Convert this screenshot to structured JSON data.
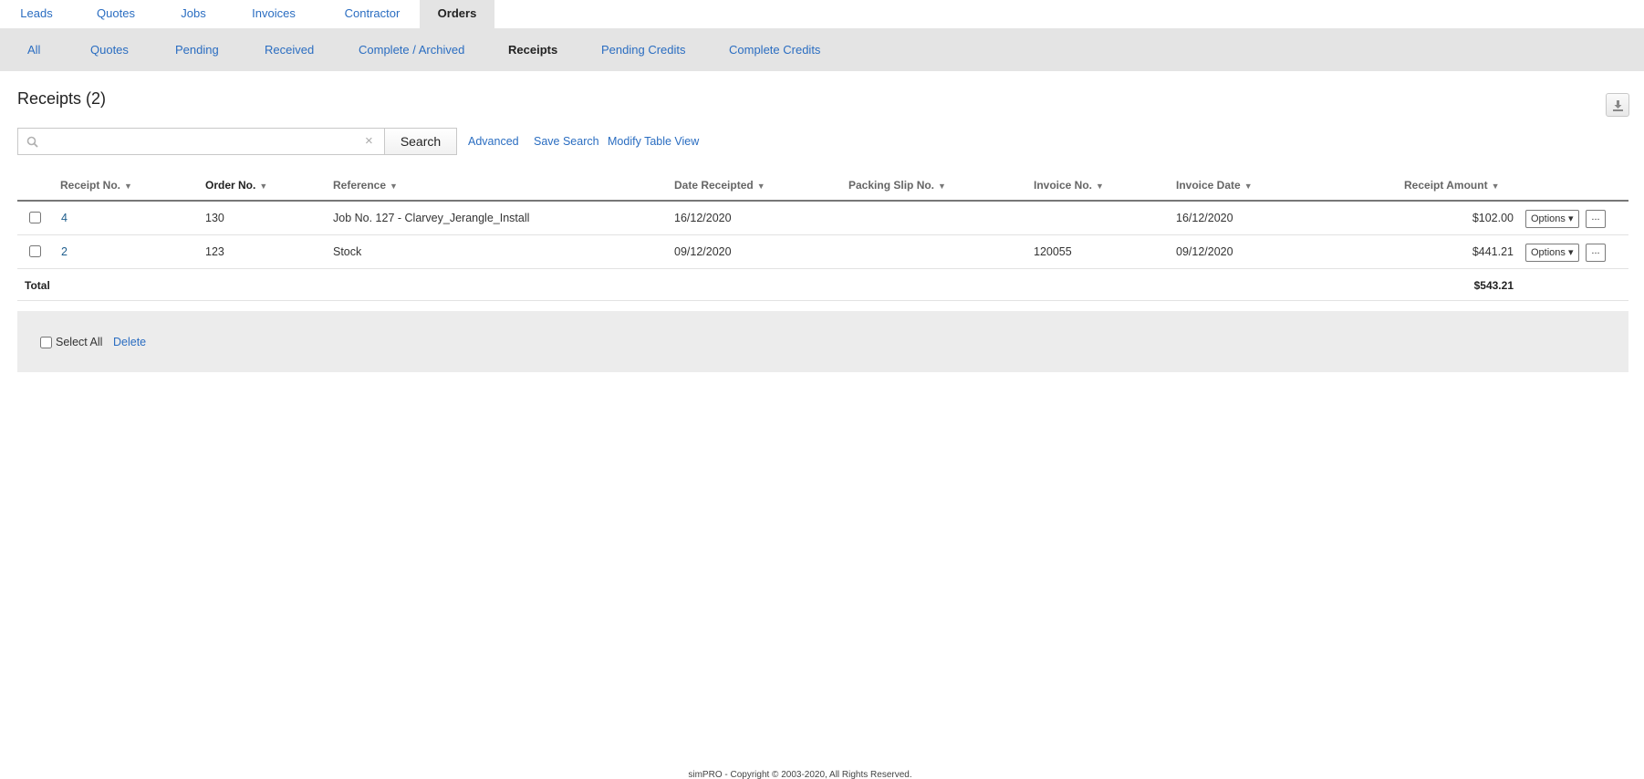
{
  "top_nav": {
    "tabs": [
      {
        "label": "Leads"
      },
      {
        "label": "Quotes"
      },
      {
        "label": "Jobs"
      },
      {
        "label": "Invoices"
      },
      {
        "label": "Contractor"
      },
      {
        "label": "Orders",
        "active": true
      }
    ]
  },
  "sub_nav": {
    "tabs": [
      {
        "label": "All"
      },
      {
        "label": "Quotes"
      },
      {
        "label": "Pending"
      },
      {
        "label": "Received"
      },
      {
        "label": "Complete / Archived"
      },
      {
        "label": "Receipts",
        "active": true
      },
      {
        "label": "Pending Credits"
      },
      {
        "label": "Complete Credits"
      }
    ]
  },
  "page": {
    "title": "Receipts (2)"
  },
  "search": {
    "value": "",
    "placeholder": "",
    "clear_glyph": "×",
    "button_label": "Search",
    "advanced_label": "Advanced",
    "save_search_label": "Save Search",
    "modify_view_label": "Modify Table View"
  },
  "table": {
    "sort_glyph": "▼",
    "columns": [
      {
        "label": "Receipt No."
      },
      {
        "label": "Order No."
      },
      {
        "label": "Reference"
      },
      {
        "label": "Date Receipted"
      },
      {
        "label": "Packing Slip No."
      },
      {
        "label": "Invoice No."
      },
      {
        "label": "Invoice Date"
      },
      {
        "label": "Receipt Amount"
      }
    ],
    "rows": [
      {
        "receipt_no": "4",
        "order_no": "130",
        "reference": "Job No. 127 - Clarvey_Jerangle_Install",
        "date_receipted": "16/12/2020",
        "packing_slip_no": "",
        "invoice_no": "",
        "invoice_date": "16/12/2020",
        "receipt_amount": "$102.00"
      },
      {
        "receipt_no": "2",
        "order_no": "123",
        "reference": "Stock",
        "date_receipted": "09/12/2020",
        "packing_slip_no": "",
        "invoice_no": "120055",
        "invoice_date": "09/12/2020",
        "receipt_amount": "$441.21"
      }
    ],
    "options_label": "Options ▾",
    "more_label": "...",
    "total_label": "Total",
    "total_amount": "$543.21"
  },
  "footer_actions": {
    "select_all_label": "Select All",
    "delete_label": "Delete"
  },
  "copyright": "simPRO - Copyright © 2003-2020, All Rights Reserved.",
  "colors": {
    "link": "#2a6dc1",
    "nav_bg": "#e4e4e4",
    "footer_bg": "#ececec"
  },
  "icons": {
    "search": "search-icon",
    "export": "download-icon",
    "clear": "close-icon"
  }
}
